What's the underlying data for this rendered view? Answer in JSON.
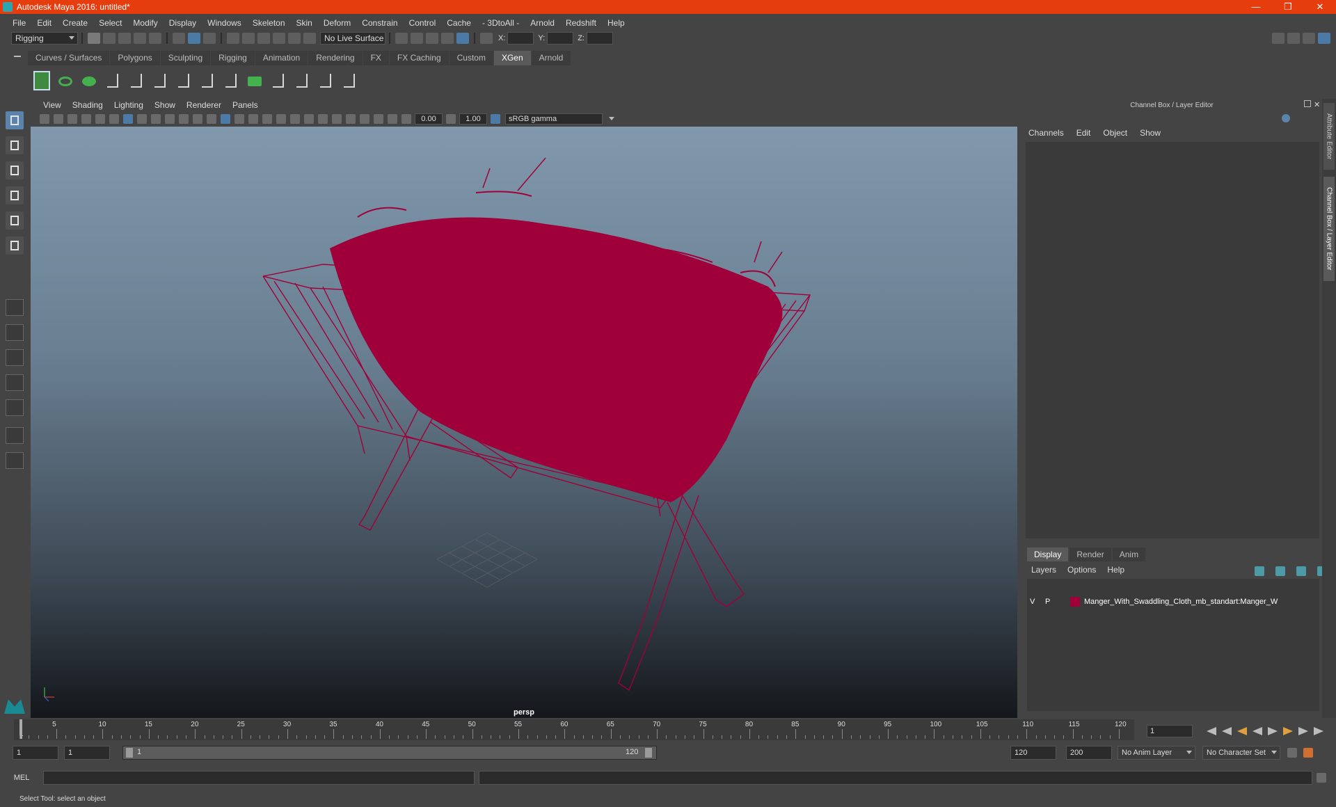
{
  "window": {
    "title": "Autodesk Maya 2016: untitled*",
    "controls": [
      "—",
      "❐",
      "✕"
    ]
  },
  "menubar": [
    "File",
    "Edit",
    "Create",
    "Select",
    "Modify",
    "Display",
    "Windows",
    "Skeleton",
    "Skin",
    "Deform",
    "Constrain",
    "Control",
    "Cache",
    "- 3DtoAll -",
    "Arnold",
    "Redshift",
    "Help"
  ],
  "statusline": {
    "menuset": "Rigging",
    "live_surface": "No Live Surface",
    "x_label": "X:",
    "y_label": "Y:",
    "z_label": "Z:"
  },
  "shelf": {
    "tabs": [
      "Curves / Surfaces",
      "Polygons",
      "Sculpting",
      "Rigging",
      "Animation",
      "Rendering",
      "FX",
      "FX Caching",
      "Custom",
      "XGen",
      "Arnold"
    ],
    "active_tab": "XGen"
  },
  "viewport": {
    "menu": [
      "View",
      "Shading",
      "Lighting",
      "Show",
      "Renderer",
      "Panels"
    ],
    "exposure": "0.00",
    "gamma_value": "1.00",
    "color_space": "sRGB gamma",
    "camera": "persp",
    "wire_color": "#a0003a"
  },
  "channel_box": {
    "title": "Channel Box / Layer Editor",
    "menu": [
      "Channels",
      "Edit",
      "Object",
      "Show"
    ]
  },
  "layer_editor": {
    "tabs": [
      "Display",
      "Render",
      "Anim"
    ],
    "active_tab": "Display",
    "menu": [
      "Layers",
      "Options",
      "Help"
    ],
    "layers": [
      {
        "v": "V",
        "p": "P",
        "color": "#a0003a",
        "name": "Manger_With_Swaddling_Cloth_mb_standart:Manger_W"
      }
    ]
  },
  "side_tabs": [
    "Attribute Editor",
    "Channel Box / Layer Editor"
  ],
  "timeslider": {
    "ticks": [
      "5",
      "10",
      "15",
      "20",
      "25",
      "30",
      "35",
      "40",
      "45",
      "50",
      "55",
      "60",
      "65",
      "70",
      "75",
      "80",
      "85",
      "90",
      "95",
      "100",
      "105",
      "110",
      "115",
      "120"
    ],
    "start_tick": "1",
    "current_frame": "1"
  },
  "range": {
    "start": "1",
    "anim_start": "1",
    "range_start_label": "1",
    "range_end_label": "120",
    "end": "120",
    "anim_end": "200",
    "anim_layer": "No Anim Layer",
    "character_set": "No Character Set"
  },
  "cmdline": {
    "label": "MEL"
  },
  "helpline": {
    "text": "Select Tool: select an object"
  }
}
